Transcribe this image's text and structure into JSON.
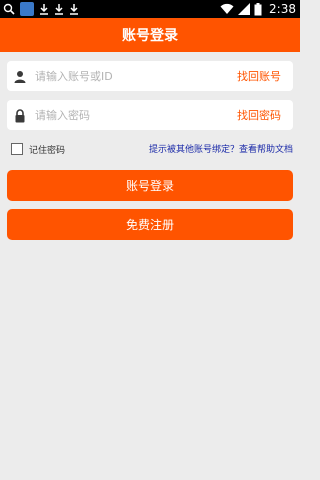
{
  "status_bar": {
    "time": "2:38",
    "left_icons": [
      "search-icon",
      "app-icon",
      "download-icon",
      "download-icon",
      "download-icon"
    ],
    "right_icons": [
      "wifi-icon",
      "signal-icon",
      "battery-icon"
    ]
  },
  "header": {
    "title": "账号登录"
  },
  "form": {
    "account": {
      "placeholder": "请输入账号或ID",
      "value": "",
      "action": "找回账号",
      "icon": "user-icon"
    },
    "password": {
      "placeholder": "请输入密码",
      "value": "",
      "action": "找回密码",
      "icon": "lock-icon"
    },
    "remember_label": "记住密码",
    "remember_checked": false,
    "help_text": "提示被其他账号绑定？查看帮助文档"
  },
  "buttons": {
    "login": "账号登录",
    "register": "免费注册"
  },
  "colors": {
    "accent": "#ff5400",
    "background": "#ececec",
    "link": "#1b2aa8"
  }
}
